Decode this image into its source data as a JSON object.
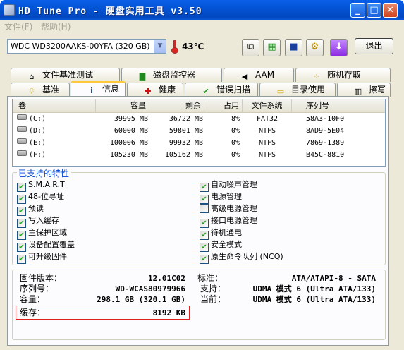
{
  "window": {
    "title": "HD Tune Pro - 硬盘实用工具 v3.50",
    "minimize": "_",
    "maximize": "□",
    "close": "✕"
  },
  "menu": [
    "文件(F)",
    "帮助(H)"
  ],
  "toolbar": {
    "drive": "WDC WD3200AAKS-00YFA (320 GB)",
    "temperature": "43℃",
    "exit_label": "退出",
    "buttons": [
      "copy-icon",
      "copy-screen-icon",
      "save-icon",
      "options-icon",
      "download-icon"
    ]
  },
  "tabs_top": [
    "文件基准测试",
    "磁盘监控器",
    "AAM",
    "随机存取"
  ],
  "tabs_bottom": [
    "基准",
    "信息",
    "健康",
    "错误扫描",
    "目录使用",
    "擦写"
  ],
  "active_tab": "信息",
  "volumes": {
    "headers": [
      "卷",
      "容量",
      "剩余",
      "占用",
      "文件系统",
      "序列号"
    ],
    "rows": [
      [
        "(C:)",
        "39995 MB",
        "36722 MB",
        "8%",
        "FAT32",
        "58A3-10F0"
      ],
      [
        "(D:)",
        "60000 MB",
        "59801 MB",
        "0%",
        "NTFS",
        "8AD9-5E04"
      ],
      [
        "(E:)",
        "100006 MB",
        "99932 MB",
        "0%",
        "NTFS",
        "7869-1389"
      ],
      [
        "(F:)",
        "105230 MB",
        "105162 MB",
        "0%",
        "NTFS",
        "B45C-8810"
      ]
    ]
  },
  "features": {
    "title": "已支持的特性",
    "left": [
      {
        "label": "S.M.A.R.T",
        "checked": true
      },
      {
        "label": "48-位寻址",
        "checked": true
      },
      {
        "label": "预读",
        "checked": true
      },
      {
        "label": "写入缓存",
        "checked": true
      },
      {
        "label": "主保护区域",
        "checked": true
      },
      {
        "label": "设备配置覆盖",
        "checked": true
      },
      {
        "label": "可升级固件",
        "checked": true
      }
    ],
    "right": [
      {
        "label": "自动噪声管理",
        "checked": true
      },
      {
        "label": "电源管理",
        "checked": true
      },
      {
        "label": "高级电源管理",
        "checked": false
      },
      {
        "label": "接口电源管理",
        "checked": true
      },
      {
        "label": "待机通电",
        "checked": true
      },
      {
        "label": "安全模式",
        "checked": true
      },
      {
        "label": "原生命令队列 (NCQ)",
        "checked": true
      }
    ]
  },
  "info": {
    "firmware_label": "固件版本：",
    "firmware": "12.01C02",
    "serial_label": "序列号：",
    "serial": "WD-WCAS80979966",
    "capacity_label": "容量：",
    "capacity": "298.1 GB (320.1 GB)",
    "cache_label": "缓存：",
    "cache": "8192 KB",
    "standard_label": "标准：",
    "standard": "ATA/ATAPI-8 - SATA",
    "supported_label": "支持：",
    "supported": "UDMA 模式 6 (Ultra ATA/133)",
    "current_label": "当前：",
    "current": "UDMA 模式 6 (Ultra ATA/133)"
  }
}
